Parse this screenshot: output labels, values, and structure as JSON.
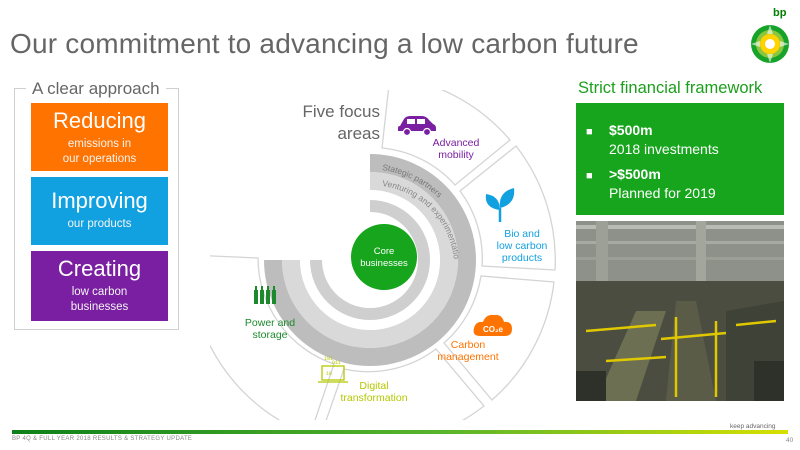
{
  "slide": {
    "title": "Our commitment to advancing a low carbon future",
    "logo_text": "bp"
  },
  "approach": {
    "label": "A clear approach",
    "cards": [
      {
        "title": "Reducing",
        "subtitle_line1": "emissions in",
        "subtitle_line2": "our operations"
      },
      {
        "title": "Improving",
        "subtitle_line1": "our products",
        "subtitle_line2": ""
      },
      {
        "title": "Creating",
        "subtitle_line1": "low carbon",
        "subtitle_line2": "businesses"
      }
    ]
  },
  "focus": {
    "title_line1": "Five focus",
    "title_line2": "areas",
    "core_line1": "Core",
    "core_line2": "businesses",
    "inner_ring_1": "Stategic partners",
    "inner_ring_2": "Venturing and experimentation",
    "areas": [
      {
        "line1": "Advanced",
        "line2": "mobility"
      },
      {
        "line1": "Bio and",
        "line2": "low carbon",
        "line3": "products"
      },
      {
        "line1": "Carbon",
        "line2": "management"
      },
      {
        "line1": "Digital",
        "line2": "transformation"
      },
      {
        "line1": "Power and",
        "line2": "storage"
      }
    ],
    "co2_icon_text": "CO₂e",
    "colors": {
      "mobility": "#7a1fa2",
      "bio": "#12a1e0",
      "carbon": "#ff7300",
      "digital": "#b5c800",
      "power": "#1c8a2c",
      "core": "#16a51c"
    }
  },
  "framework": {
    "title": "Strict financial framework",
    "items": [
      {
        "bold": "$500m",
        "text": "2018 investments"
      },
      {
        "bold": ">$500m",
        "text": "Planned for 2019"
      }
    ]
  },
  "footer": {
    "left": "BP 4Q & FULL YEAR 2018 RESULTS & STRATEGY UPDATE",
    "tagline": "keep advancing",
    "page": "40"
  }
}
